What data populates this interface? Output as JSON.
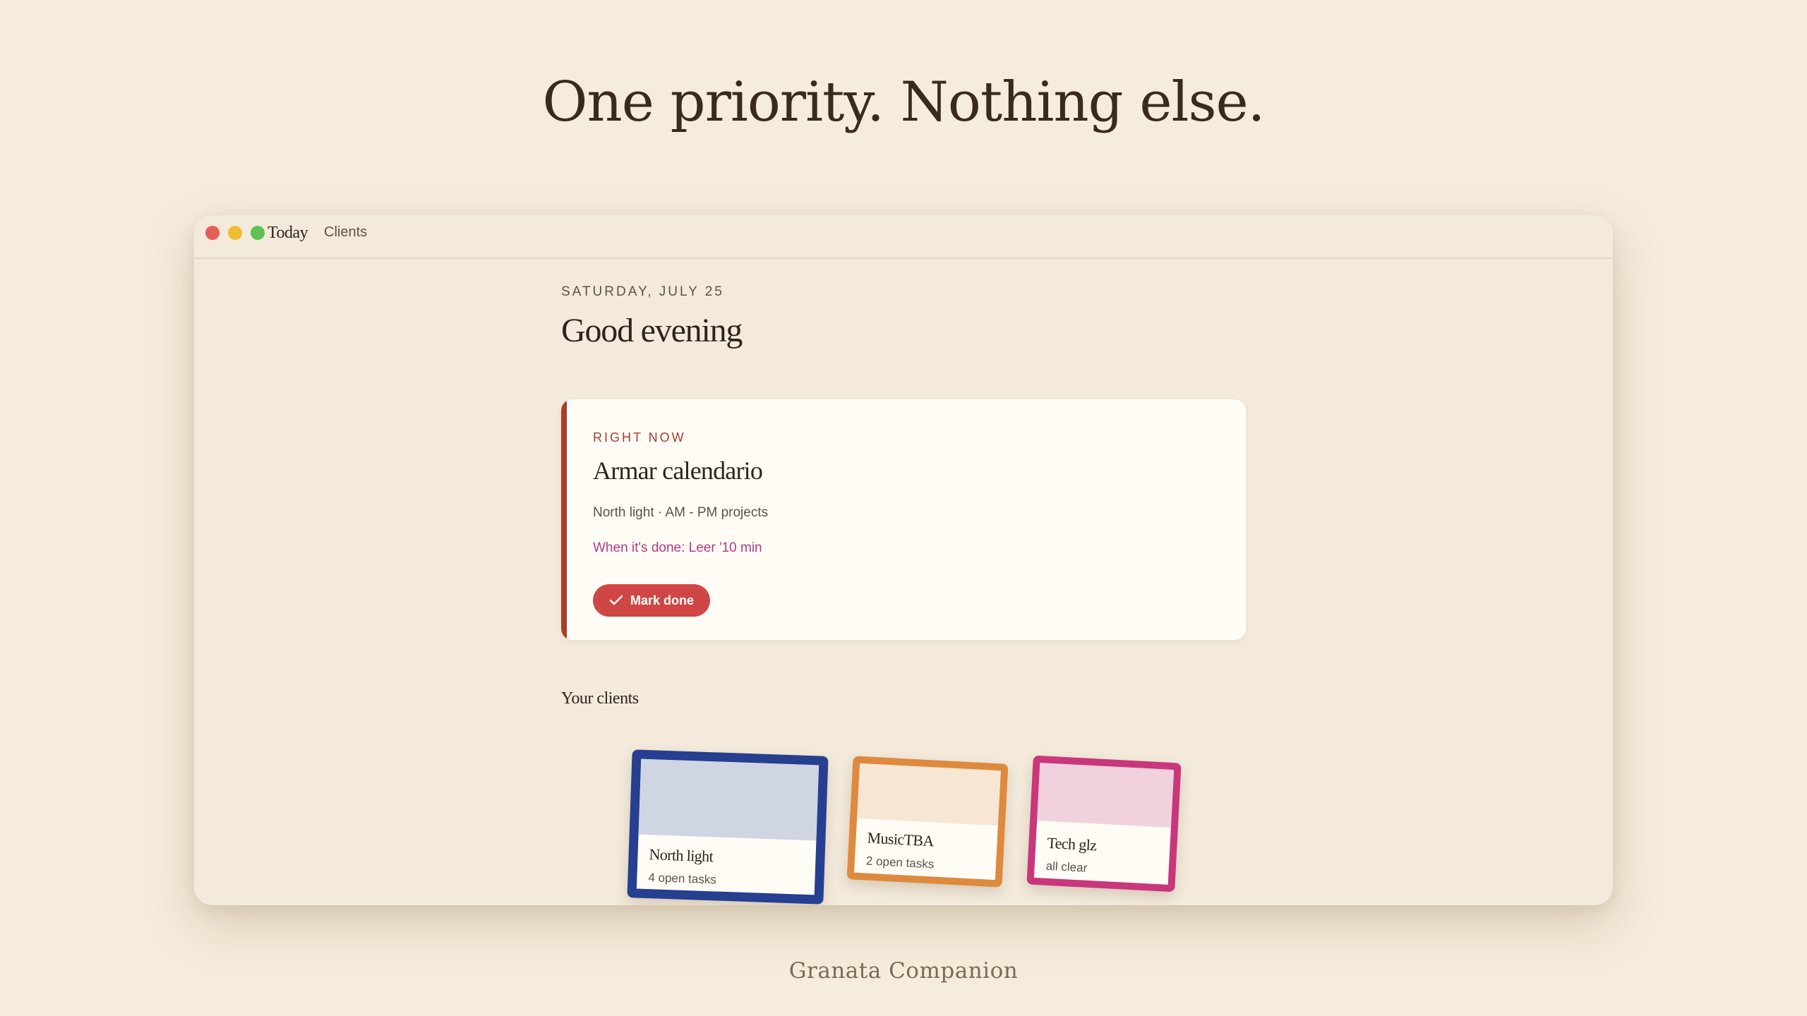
{
  "headline": "One priority. Nothing else.",
  "window": {
    "nav": {
      "today": "Today",
      "clients": "Clients"
    }
  },
  "main": {
    "date": "SATURDAY, JULY 25",
    "greeting": "Good evening",
    "priority": {
      "label": "RIGHT NOW",
      "title": "Armar calendario",
      "meta": "North light · AM - PM projects",
      "next": "When it's done: Leer '10 min",
      "button_label": "Mark done",
      "accent": "#a53f2e",
      "button_color": "#cf4744"
    },
    "clients_heading": "Your clients",
    "clients": [
      {
        "name": "North light",
        "tasks": "4 open tasks",
        "color": "#263f91"
      },
      {
        "name": "MusicTBA",
        "tasks": "2 open tasks",
        "color": "#de8a3e"
      },
      {
        "name": "Tech glz",
        "tasks": "all clear",
        "color": "#c8377c"
      }
    ]
  },
  "footer": "Granata Companion"
}
